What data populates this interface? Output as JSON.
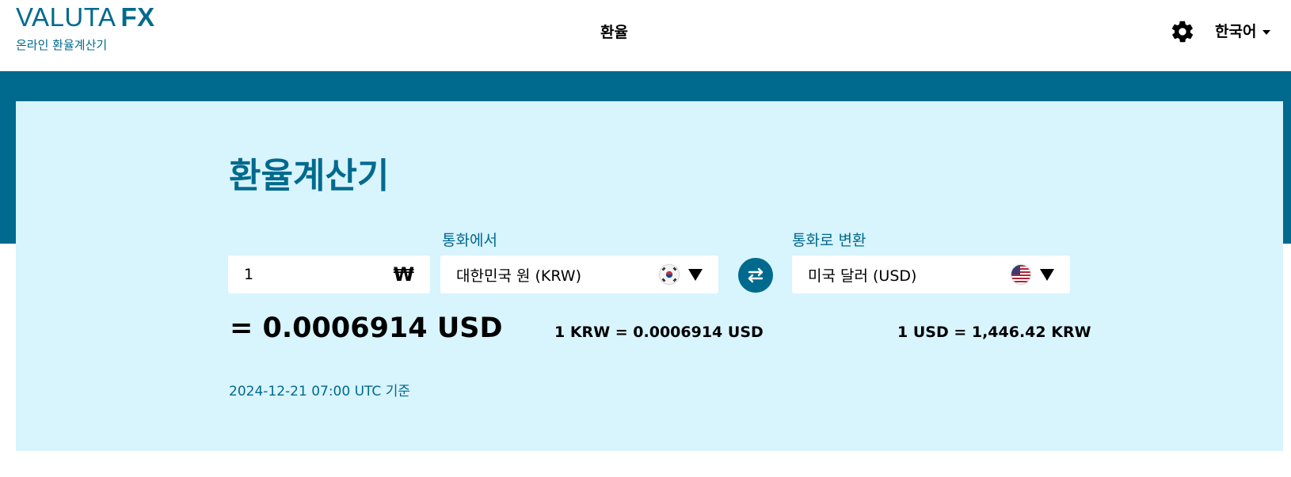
{
  "header": {
    "logo_main": "VALUTA",
    "logo_bold": "FX",
    "logo_sub": "온라인 환율계산기",
    "nav_link": "환율",
    "settings_icon": "gear-icon",
    "language": "한국어"
  },
  "converter": {
    "title": "환율계산기",
    "from_label": "통화에서",
    "to_label": "통화로 변환",
    "amount": "1",
    "amount_symbol": "₩",
    "from_currency": "대한민국 원 (KRW)",
    "to_currency": "미국 달러 (USD)",
    "swap_icon": "swap-arrows-icon",
    "result": "= 0.0006914 USD",
    "rate_forward": "1 KRW = 0.0006914 USD",
    "rate_reverse": "1 USD = 1,446.42 KRW",
    "timestamp": "2024-12-21 07:00 UTC 기준"
  },
  "colors": {
    "brand": "#006a8e",
    "panel": "#d8f4fd"
  }
}
